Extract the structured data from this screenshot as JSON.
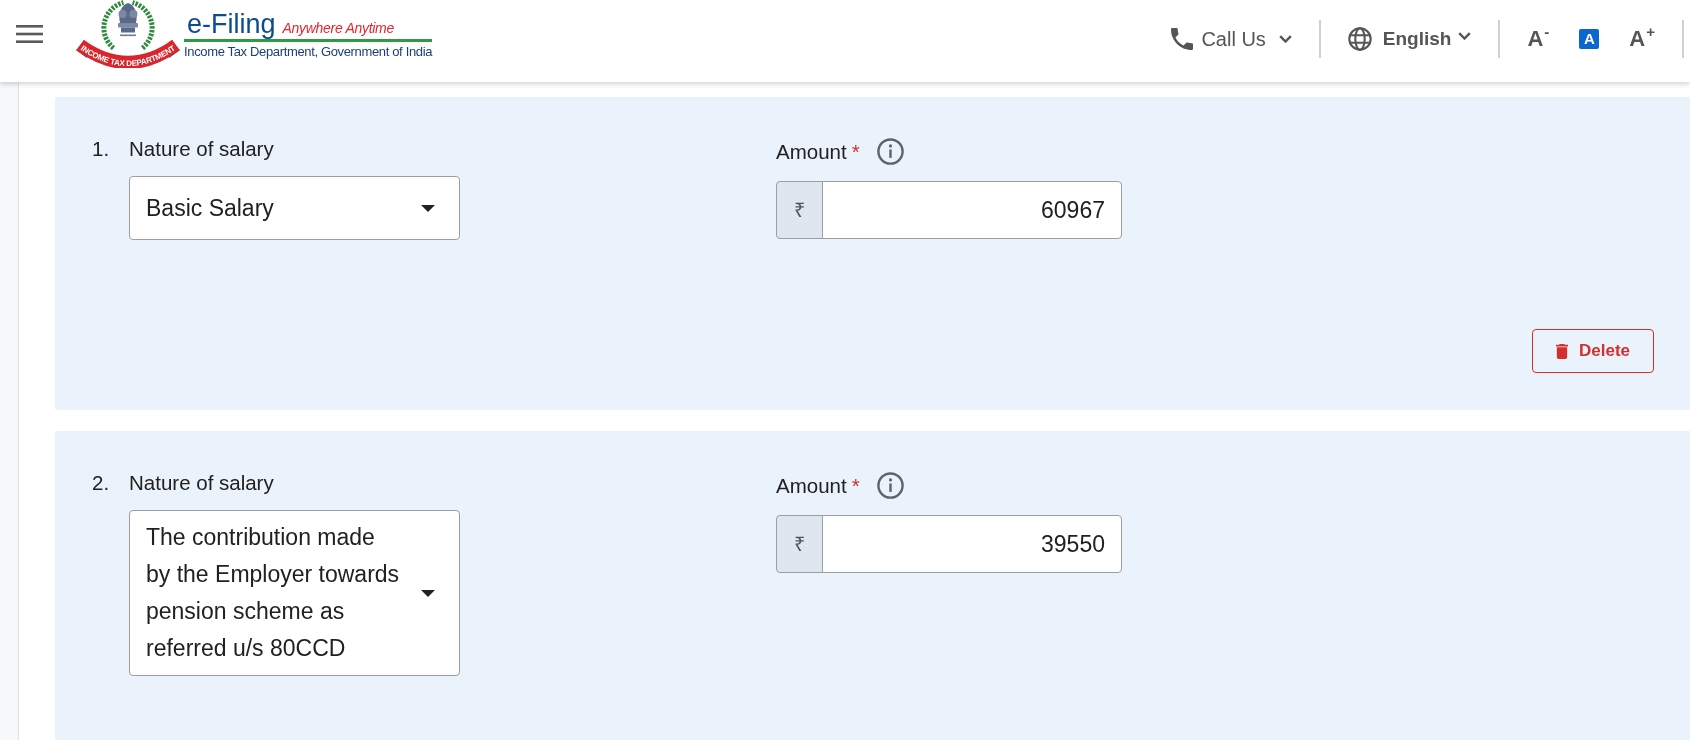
{
  "header": {
    "logo": {
      "ribbon_text": "INCOME TAX DEPARTMENT",
      "title": "e-Filing",
      "tagline": "Anywhere Anytime",
      "subtitle": "Income Tax Department, Government of India"
    },
    "call_us": {
      "label": "Call Us"
    },
    "language": {
      "label": "English"
    },
    "text_size_buttons": [
      {
        "label": "A$^{-}$",
        "selected": false
      },
      {
        "label": "A",
        "selected": true
      },
      {
        "label": "A$^{+}$",
        "selected": false
      }
    ]
  },
  "salary_entries": [
    {
      "number": "1.",
      "nature_label": "Nature of salary",
      "nature_value": "Basic Salary",
      "amount_label": "Amount",
      "required_mark": "*",
      "currency": "₹",
      "amount": "60967",
      "delete_button": "Delete"
    },
    {
      "number": "2.",
      "nature_label": "Nature of salary",
      "nature_value": "The contribution made by the Employer towards pension scheme as referred u/s 80CCD",
      "amount_label": "Amount",
      "required_mark": "*",
      "currency": "₹",
      "amount": "39550"
    }
  ]
}
